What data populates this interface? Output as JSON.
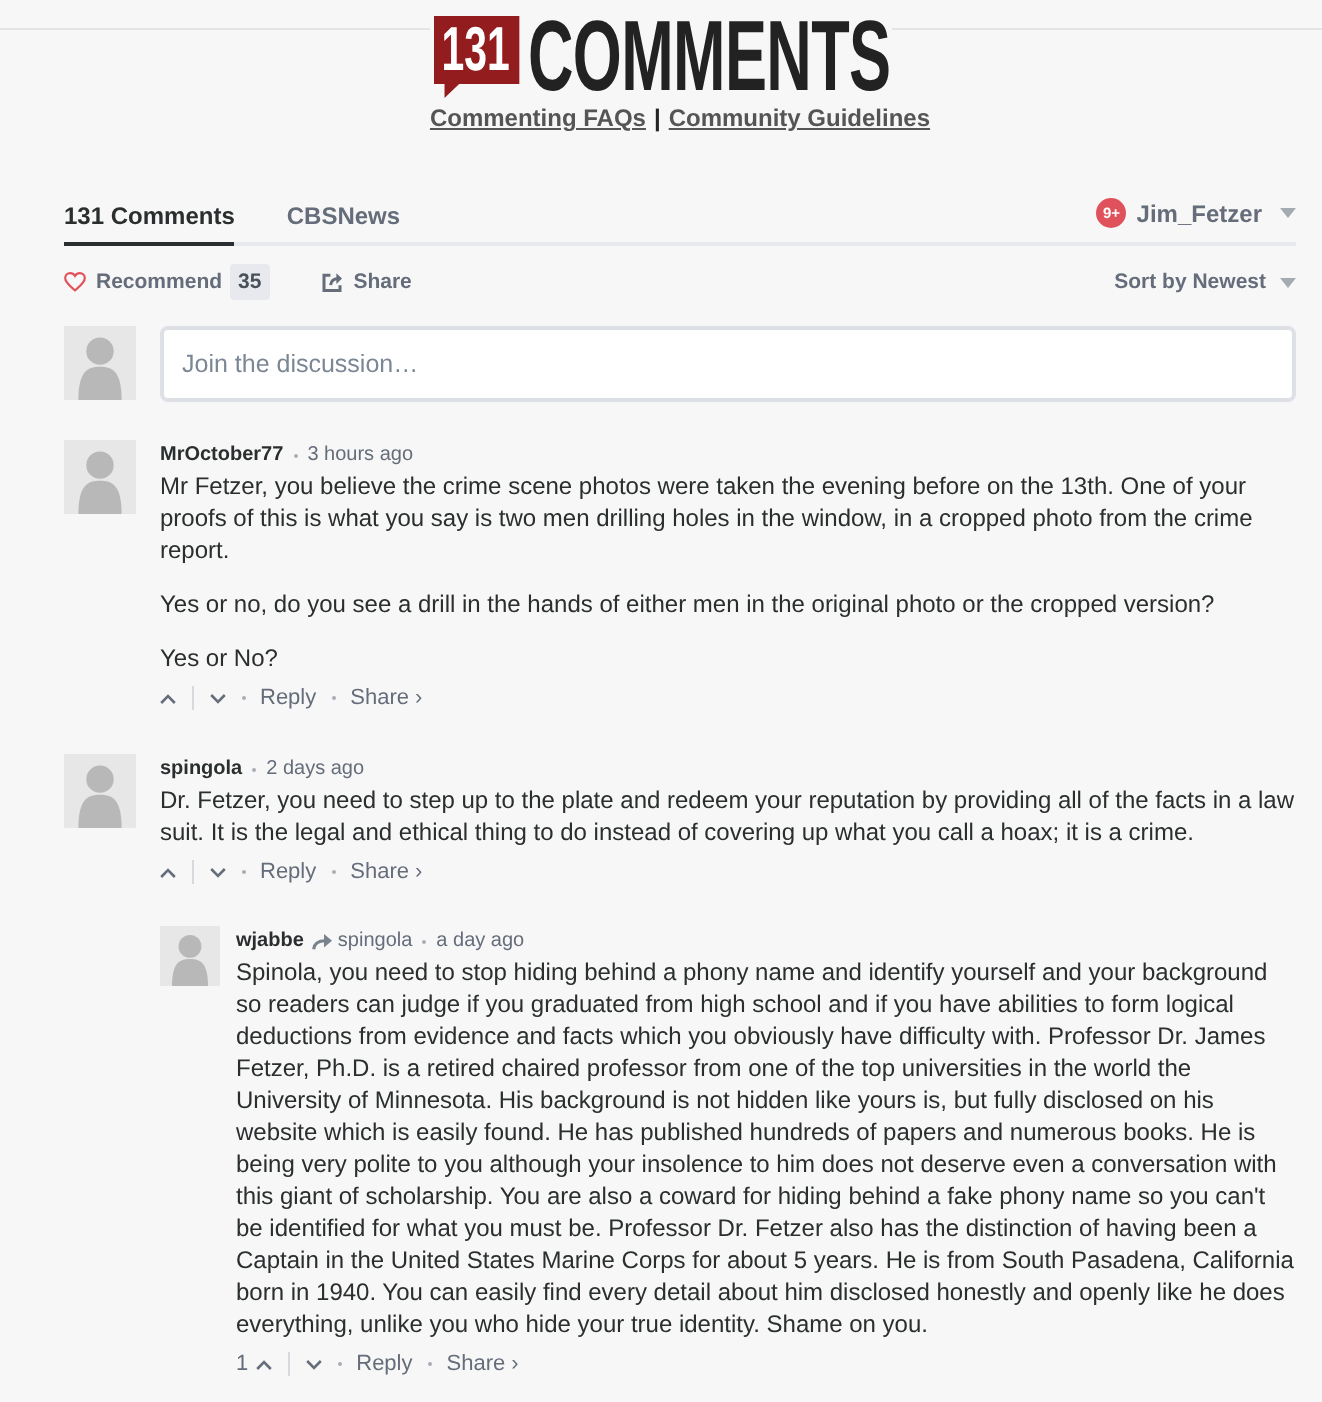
{
  "header": {
    "logo": {
      "count": "131",
      "word": "COMMENTS"
    },
    "links": [
      {
        "label": "Commenting FAQs"
      },
      {
        "label": "Community Guidelines"
      }
    ],
    "link_separator": "|"
  },
  "tabs": [
    {
      "label": "131 Comments",
      "selected": true
    },
    {
      "label": "CBSNews",
      "selected": false
    }
  ],
  "user_menu": {
    "notification_count": "9+",
    "username": "Jim_Fetzer"
  },
  "toolbar": {
    "recommend": {
      "label": "Recommend",
      "count": "35",
      "recommended": false
    },
    "share": {
      "label": "Share"
    },
    "sort": {
      "label": "Sort by Newest"
    }
  },
  "composer": {
    "placeholder": "Join the discussion…"
  },
  "comments": [
    {
      "author": "MrOctober77",
      "time": "3 hours ago",
      "paragraphs": [
        "Mr Fetzer, you believe the crime scene photos were taken the evening before on the 13th. One of your proofs of this is what you say is two men drilling holes in the window, in a cropped photo from the crime report.",
        "Yes or no, do you see a drill in the hands of either men in the original photo or the cropped version?",
        "Yes or No?"
      ],
      "reply_label": "Reply",
      "share_label": "Share ›"
    },
    {
      "author": "spingola",
      "time": "2 days ago",
      "paragraphs": [
        "Dr. Fetzer, you need to step up to the plate and redeem your reputation by providing all of the facts in a law suit. It is the legal and ethical thing to do instead of covering up what you call a hoax; it is a crime."
      ],
      "reply_label": "Reply",
      "share_label": "Share ›",
      "replies": [
        {
          "author": "wjabbe",
          "in_reply_to": "spingola",
          "time": "a day ago",
          "paragraphs": [
            "Spinola, you need to stop hiding behind a phony name and identify yourself and your background so readers can judge if you graduated from high school and if you have abilities to form logical deductions from evidence and facts which you obviously have difficulty with. Professor Dr. James Fetzer, Ph.D. is a retired chaired professor from one of the top universities in the world the University of Minnesota. His background is not hidden like yours is, but fully disclosed on his website which is easily found. He has published hundreds of papers and numerous books. He is being very polite to you although your insolence to him does not deserve even a conversation with this giant of scholarship. You are also a coward for hiding behind a fake phony name so you can't be identified for what you must be. Professor Dr. Fetzer also has the distinction of having been a Captain in the United States Marine Corps for about 5 years. He is from South Pasadena, California born in 1940. You can easily find every detail about him disclosed honestly and openly like he does everything, unlike you who hide your true identity. Shame on you."
          ],
          "upvotes": "1",
          "reply_label": "Reply",
          "share_label": "Share ›"
        }
      ]
    }
  ]
}
